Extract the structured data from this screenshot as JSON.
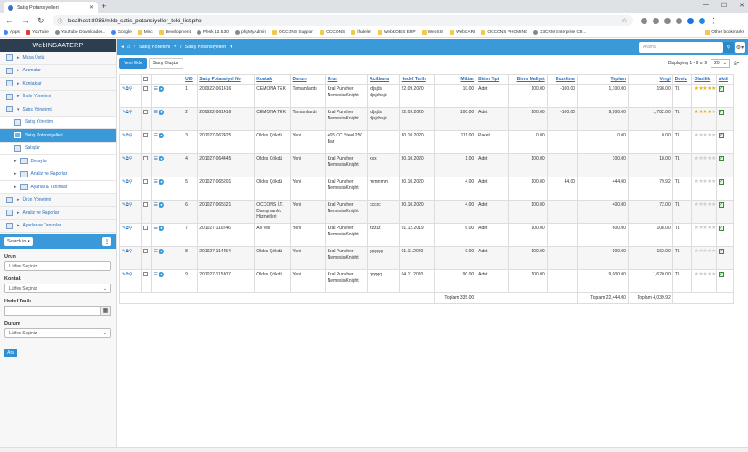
{
  "browser": {
    "tab_title": "Satış Potansiyelleri",
    "url": "localhost:8086/mkb_satis_potansiyeller_toki_list.php",
    "bookmarks": [
      "Apps",
      "YouTube",
      "YouTube Downloader...",
      "Google",
      "Misc",
      "Development",
      "Plesk 12.5.30",
      "phpMyAdmin",
      "OCCONS Support",
      "OCCONS",
      "İhaleler",
      "WebKOBIS ERP",
      "WebSIS",
      "WebCARI",
      "OCCONS PHOMINE",
      "X3CRM Enterprise CR..."
    ],
    "other_bookmarks": "Other bookmarks"
  },
  "sidebar": {
    "brand": "WebINSAATERP",
    "items": [
      {
        "label": "Masa Üstü"
      },
      {
        "label": "Aramalar"
      },
      {
        "label": "Kontaklar"
      },
      {
        "label": "İhale Yönetimi"
      },
      {
        "label": "Satış Yönetimi"
      },
      {
        "label": "Satış Yönetimi"
      },
      {
        "label": "Satış Potansiyelleri"
      },
      {
        "label": "Satışlar"
      },
      {
        "label": "Detaylar"
      },
      {
        "label": "Analiz ve Raporlar"
      },
      {
        "label": "Ayarlar & Tanımlar"
      },
      {
        "label": "Ürün Yönetimi"
      },
      {
        "label": "Analiz ve Raporlar"
      },
      {
        "label": "Ayarlar ve Tanımlar"
      }
    ],
    "search_in": "Search in",
    "filters": {
      "urun_label": "Urun",
      "urun_value": "Lütfen Seçiniz",
      "kontak_label": "Kontak",
      "kontak_value": "Lütfen Seçiniz",
      "hedef_label": "Hedef Tarih",
      "durum_label": "Durum",
      "durum_value": "Lütfen Seçiniz"
    },
    "search_button": "Ara"
  },
  "topbar": {
    "crumb1": "Satış Yönetimi",
    "crumb2": "Satış Potansiyelleri",
    "search_placeholder": "Arama"
  },
  "toolbar": {
    "add_label": "Yeni Ekle",
    "create_label": "Satış Oluştur",
    "paging": "Displaying 1 - 9 of 9",
    "per_page": "20"
  },
  "columns": [
    "UID",
    "Satış Potansiyel No",
    "Kontak",
    "Durum",
    "Urun",
    "Aciklama",
    "Hedef Tarih",
    "Miktar",
    "Birim Tipi",
    "Birim Maliyet",
    "Duzeltme",
    "Toplam",
    "Vergi",
    "Doviz",
    "Olasilik",
    "Aktif"
  ],
  "rows": [
    {
      "uid": "1",
      "no": "200922-061416",
      "kontak": "CEMONA TEK",
      "durum": "Tamamlandı",
      "urun": "Kral Puncher Nemesis/Knight",
      "aciklama": "idjsjds djsjdhsjd",
      "tarih": "22.09.2020",
      "miktar": "10.00",
      "birim": "Adet",
      "maliyet": "100.00",
      "duzeltme": "-100.00",
      "toplam": "1,100.00",
      "vergi": "198.00",
      "doviz": "TL",
      "stars": 5
    },
    {
      "uid": "2",
      "no": "200922-061416",
      "kontak": "CEMONA TEK",
      "durum": "Tamamlandı",
      "urun": "Kral Puncher Nemesis/Knight",
      "aciklama": "idjsjds djsjdhsjd",
      "tarih": "22.09.2020",
      "miktar": "100.00",
      "birim": "Adet",
      "maliyet": "100.00",
      "duzeltme": "-100.00",
      "toplam": "9,900.00",
      "vergi": "1,782.00",
      "doviz": "TL",
      "stars": 4
    },
    {
      "uid": "3",
      "no": "201027-062425",
      "kontak": "Oldes Çökdü",
      "durum": "Yeni",
      "urun": "465 CC Steel 250 Bar",
      "aciklama": "",
      "tarih": "30.10.2020",
      "miktar": "111.00",
      "birim": "Paket",
      "maliyet": "0.00",
      "duzeltme": "",
      "toplam": "0.00",
      "vergi": "0.00",
      "doviz": "TL",
      "stars": 0
    },
    {
      "uid": "4",
      "no": "201027-064445",
      "kontak": "Oldes Çökdü",
      "durum": "Yeni",
      "urun": "Kral Puncher Nemesis/Knight",
      "aciklama": "xxx",
      "tarih": "30.10.2020",
      "miktar": "1.00",
      "birim": "Adet",
      "maliyet": "100.00",
      "duzeltme": "",
      "toplam": "100.00",
      "vergi": "18.00",
      "doviz": "TL",
      "stars": 0
    },
    {
      "uid": "5",
      "no": "201027-065201",
      "kontak": "Oldes Çökdü",
      "durum": "Yeni",
      "urun": "Kral Puncher Nemesis/Knight",
      "aciklama": "mmmmm",
      "tarih": "30.10.2020",
      "miktar": "4.00",
      "birim": "Adet",
      "maliyet": "100.00",
      "duzeltme": "44.00",
      "toplam": "444.00",
      "vergi": "79.92",
      "doviz": "TL",
      "stars": 0
    },
    {
      "uid": "6",
      "no": "201027-065621",
      "kontak": "OCCONS İ.T. Danışmanlık Hizmetleri",
      "durum": "Yeni",
      "urun": "Kral Puncher Nemesis/Knight",
      "aciklama": "ccccc",
      "tarih": "30.10.2020",
      "miktar": "4.00",
      "birim": "Adet",
      "maliyet": "100.00",
      "duzeltme": "",
      "toplam": "400.00",
      "vergi": "72.00",
      "doviz": "TL",
      "stars": 0
    },
    {
      "uid": "7",
      "no": "201027-110246",
      "kontak": "Ali Veli",
      "durum": "Yeni",
      "urun": "Kral Puncher Nemesis/Knight",
      "aciklama": "zzzzz",
      "tarih": "01.12.2019",
      "miktar": "6.00",
      "birim": "Adet",
      "maliyet": "100.00",
      "duzeltme": "",
      "toplam": "600.00",
      "vergi": "108.00",
      "doviz": "TL",
      "stars": 0
    },
    {
      "uid": "8",
      "no": "201027-114454",
      "kontak": "Oldes Çökdü",
      "durum": "Yeni",
      "urun": "Kral Puncher Nemesis/Knight",
      "aciklama": "şşşşşş",
      "tarih": "01.11.2020",
      "miktar": "9.00",
      "birim": "Adet",
      "maliyet": "100.00",
      "duzeltme": "",
      "toplam": "900.00",
      "vergi": "162.00",
      "doviz": "TL",
      "stars": 0
    },
    {
      "uid": "9",
      "no": "201027-115307",
      "kontak": "Oldes Çökdü",
      "durum": "Yeni",
      "urun": "Kral Puncher Nemesis/Knight",
      "aciklama": "qqqqq",
      "tarih": "04.11.2020",
      "miktar": "90.00",
      "birim": "Adet",
      "maliyet": "100.00",
      "duzeltme": "",
      "toplam": "9,000.00",
      "vergi": "1,620.00",
      "doviz": "TL",
      "stars": 0
    }
  ],
  "totals": {
    "miktar": "Toplam 335.00",
    "toplam": "Toplam 22,444.00",
    "vergi": "Toplam 4,039.92"
  }
}
